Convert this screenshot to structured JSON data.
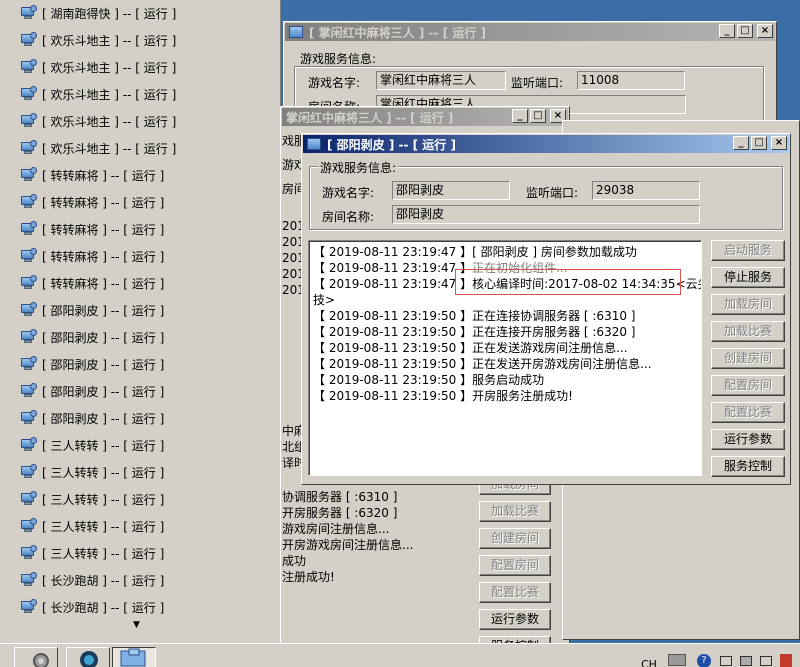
{
  "task_list": {
    "items": [
      "[ 湖南跑得快 ] -- [ 运行 ]",
      "[ 欢乐斗地主 ] -- [ 运行 ]",
      "[ 欢乐斗地主 ] -- [ 运行 ]",
      "[ 欢乐斗地主 ] -- [ 运行 ]",
      "[ 欢乐斗地主 ] -- [ 运行 ]",
      "[ 欢乐斗地主 ] -- [ 运行 ]",
      "[ 转转麻将 ] -- [ 运行 ]",
      "[ 转转麻将 ] -- [ 运行 ]",
      "[ 转转麻将 ] -- [ 运行 ]",
      "[ 转转麻将 ] -- [ 运行 ]",
      "[ 转转麻将 ] -- [ 运行 ]",
      "[ 邵阳剥皮 ] -- [ 运行 ]",
      "[ 邵阳剥皮 ] -- [ 运行 ]",
      "[ 邵阳剥皮 ] -- [ 运行 ]",
      "[ 邵阳剥皮 ] -- [ 运行 ]",
      "[ 邵阳剥皮 ] -- [ 运行 ]",
      "[ 三人转转 ] -- [ 运行 ]",
      "[ 三人转转 ] -- [ 运行 ]",
      "[ 三人转转 ] -- [ 运行 ]",
      "[ 三人转转 ] -- [ 运行 ]",
      "[ 三人转转 ] -- [ 运行 ]",
      "[ 长沙跑胡 ] -- [ 运行 ]",
      "[ 长沙跑胡 ] -- [ 运行 ]"
    ]
  },
  "win_back1": {
    "title": "[ 掌闲红中麻将三人 ] -- [ 运行 ]",
    "group_title": "游戏服务信息:",
    "game_name_label": "游戏名字:",
    "game_name_value": "掌闲红中麻将三人",
    "port_label": "监听端口:",
    "port_value": "11008",
    "room_label": "房间名称:",
    "room_value": "掌闲红中麻将三人"
  },
  "win_back2": {
    "title": "掌闲红中麻将三人 ] -- [ 运行 ]",
    "frag_left": [
      "戏服",
      "游戏",
      "房间",
      "201",
      "201",
      "201",
      "201",
      "201",
      "中麻",
      "北组",
      "译时"
    ],
    "frag_logs": [
      "协调服务器 [ :6310 ]",
      "开房服务器 [ :6320 ]",
      "游戏房间注册信息...",
      "开房游戏房间注册信息...",
      "成功",
      "注册成功!"
    ],
    "buttons": [
      "加载房间",
      "加载比赛",
      "创建房间",
      "配置房间",
      "配置比赛",
      "运行参数",
      "服务控制"
    ]
  },
  "win_main": {
    "title": "[ 邵阳剥皮 ] -- [ 运行 ]",
    "group_title": "游戏服务信息:",
    "game_name_label": "游戏名字:",
    "game_name_value": "邵阳剥皮",
    "port_label": "监听端口:",
    "port_value": "29038",
    "room_label": "房间名称:",
    "room_value": "邵阳剥皮",
    "log": [
      {
        "ts": "【 2019-08-11 23:19:47 】",
        "msg": "[ 邵阳剥皮 ] 房间参数加载成功"
      },
      {
        "ts": "【 2019-08-11 23:19:47 】",
        "msg": "正在初始化组件..."
      },
      {
        "ts": "【 2019-08-11 23:19:47 】",
        "msg": "核心编译时间:2017-08-02 14:34:35<云尖科"
      },
      {
        "ts": "",
        "msg": "技>"
      },
      {
        "ts": "【 2019-08-11 23:19:50 】",
        "msg": "正在连接协调服务器 [ :6310 ]"
      },
      {
        "ts": "【 2019-08-11 23:19:50 】",
        "msg": "正在连接开房服务器 [ :6320 ]"
      },
      {
        "ts": "【 2019-08-11 23:19:50 】",
        "msg": "正在发送游戏房间注册信息..."
      },
      {
        "ts": "【 2019-08-11 23:19:50 】",
        "msg": "正在发送开房游戏房间注册信息..."
      },
      {
        "ts": "【 2019-08-11 23:19:50 】",
        "msg": "服务启动成功"
      },
      {
        "ts": "【 2019-08-11 23:19:50 】",
        "msg": "开房服务注册成功!"
      }
    ],
    "buttons": [
      "启动服务",
      "停止服务",
      "加载房间",
      "加载比赛",
      "创建房间",
      "配置房间",
      "配置比赛",
      "运行参数",
      "服务控制"
    ],
    "highlight_color": "#d9534f"
  },
  "taskbar": {
    "tray": [
      "CH",
      "?"
    ]
  }
}
